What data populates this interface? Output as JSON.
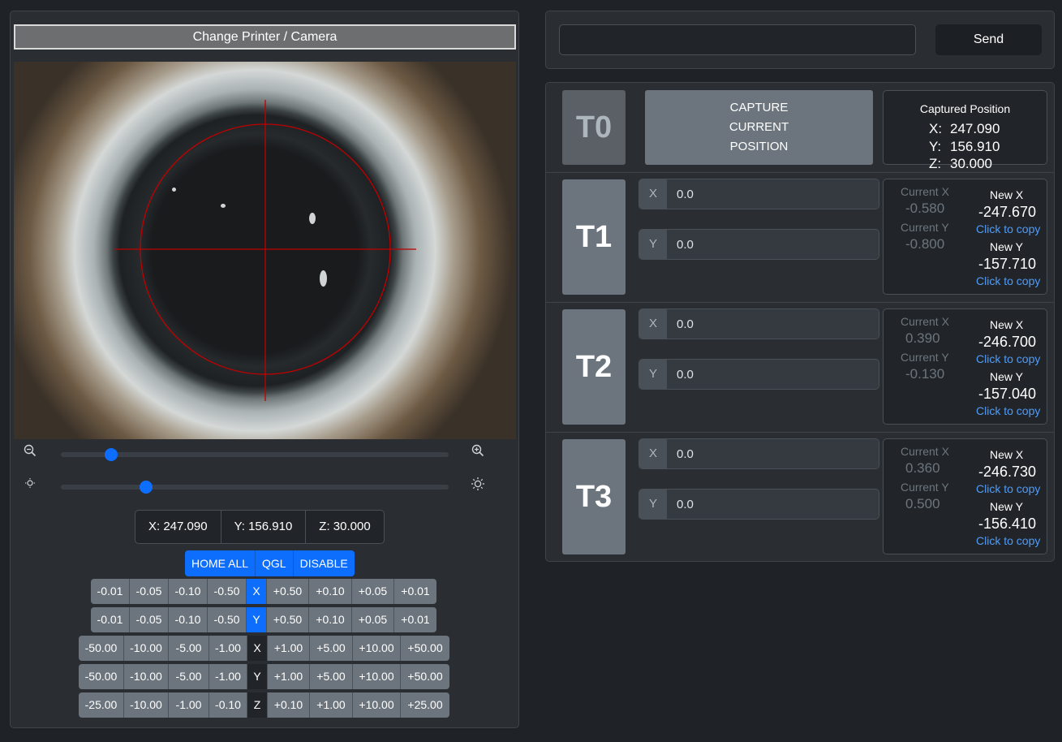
{
  "left": {
    "change_button": "Change Printer / Camera",
    "zoom_level": 0.13,
    "brightness_level": 0.22,
    "coords": {
      "x": "X: 247.090",
      "y": "Y: 156.910",
      "z": "Z: 30.000"
    },
    "home_buttons": [
      "HOME ALL",
      "QGL",
      "DISABLE"
    ],
    "fine_steps_neg": [
      "-0.01",
      "-0.05",
      "-0.10",
      "-0.50"
    ],
    "fine_steps_pos": [
      "+0.50",
      "+0.10",
      "+0.05",
      "+0.01"
    ],
    "coarse_steps_neg": [
      "-50.00",
      "-10.00",
      "-5.00",
      "-1.00"
    ],
    "coarse_steps_pos": [
      "+1.00",
      "+5.00",
      "+10.00",
      "+50.00"
    ],
    "z_steps_neg": [
      "-25.00",
      "-10.00",
      "-1.00",
      "-0.10"
    ],
    "z_steps_pos": [
      "+0.10",
      "+1.00",
      "+10.00",
      "+25.00"
    ],
    "axis_x": "X",
    "axis_y": "Y",
    "axis_z": "Z",
    "colors": {
      "accent": "#0d6efd",
      "crosshair": "#c00000"
    }
  },
  "command": {
    "value": "",
    "send_label": "Send"
  },
  "t0": {
    "label": "T0",
    "capture_lines": [
      "CAPTURE",
      "CURRENT",
      "POSITION"
    ],
    "captured_title": "Captured Position",
    "x_label": "X:",
    "x": "247.090",
    "y_label": "Y:",
    "y": "156.910",
    "z_label": "Z:",
    "z": "30.000"
  },
  "tools": [
    {
      "label": "T1",
      "x_prefix": "X",
      "y_prefix": "Y",
      "x_input": "0.0",
      "y_input": "0.0",
      "current_x_label": "Current X",
      "current_x": "-0.580",
      "current_y_label": "Current Y",
      "current_y": "-0.800",
      "new_x_label": "New X",
      "new_x": "-247.670",
      "new_y_label": "New Y",
      "new_y": "-157.710",
      "copy": "Click to copy"
    },
    {
      "label": "T2",
      "x_prefix": "X",
      "y_prefix": "Y",
      "x_input": "0.0",
      "y_input": "0.0",
      "current_x_label": "Current X",
      "current_x": "0.390",
      "current_y_label": "Current Y",
      "current_y": "-0.130",
      "new_x_label": "New X",
      "new_x": "-246.700",
      "new_y_label": "New Y",
      "new_y": "-157.040",
      "copy": "Click to copy"
    },
    {
      "label": "T3",
      "x_prefix": "X",
      "y_prefix": "Y",
      "x_input": "0.0",
      "y_input": "0.0",
      "current_x_label": "Current X",
      "current_x": "0.360",
      "current_y_label": "Current Y",
      "current_y": "0.500",
      "new_x_label": "New X",
      "new_x": "-246.730",
      "new_y_label": "New Y",
      "new_y": "-156.410",
      "copy": "Click to copy"
    }
  ]
}
